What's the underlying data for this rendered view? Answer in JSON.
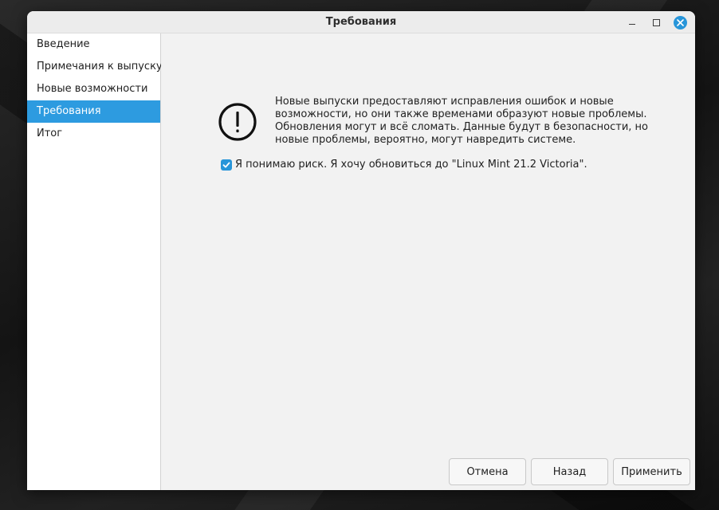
{
  "window": {
    "title": "Требования",
    "controls": {
      "minimize_icon": "minimize-icon",
      "maximize_icon": "maximize-icon",
      "close_icon": "close-icon"
    }
  },
  "sidebar": {
    "items": [
      {
        "label": "Введение",
        "active": false
      },
      {
        "label": "Примечания к выпуску",
        "active": false
      },
      {
        "label": "Новые возможности",
        "active": false
      },
      {
        "label": "Требования",
        "active": true
      },
      {
        "label": "Итог",
        "active": false
      }
    ]
  },
  "main": {
    "warning": {
      "icon": "exclamation-circle-icon",
      "text": "Новые выпуски предоставляют исправления ошибок и новые возможности, но они также временами образуют новые проблемы. Обновления могут и всё сломать. Данные будут в безопасности, но новые проблемы, вероятно, могут навредить системе."
    },
    "risk_checkbox": {
      "checked": true,
      "label": "Я понимаю риск. Я хочу обновиться до \"Linux Mint 21.2 Victoria\"."
    }
  },
  "buttons": {
    "cancel_label": "Отмена",
    "back_label": "Назад",
    "apply_label": "Применить"
  },
  "colors": {
    "accent": "#2d9be0",
    "window_bg": "#f2f2f2",
    "sidebar_bg": "#ffffff"
  }
}
